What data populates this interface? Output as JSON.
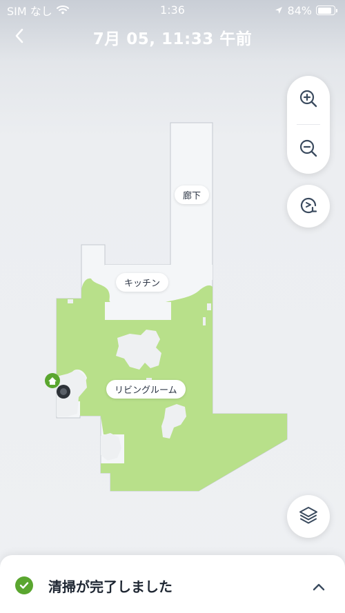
{
  "status_bar": {
    "carrier": "SIM なし",
    "time": "1:36",
    "battery_text": "84%",
    "battery_level": 0.84
  },
  "header": {
    "title": "7月 05, 11:33 午前"
  },
  "map": {
    "rooms": [
      {
        "name": "廊下"
      },
      {
        "name": "キッチン"
      },
      {
        "name": "リビングルーム"
      }
    ],
    "colors": {
      "cleaned": "#b8e08a",
      "uncleaned": "#f4f6f8",
      "wall": "#c3c8cf",
      "dock": "#5aa62f"
    },
    "icons": {
      "dock": "home-icon",
      "robot": "robot-icon"
    }
  },
  "controls": {
    "zoom_in_icon": "zoom-in-icon",
    "zoom_out_icon": "zoom-out-icon",
    "rotate_icon": "rotate-icon",
    "layers_icon": "layers-icon"
  },
  "bottom_sheet": {
    "status": "清掃が完了しました",
    "status_color": "#5aa62f"
  }
}
